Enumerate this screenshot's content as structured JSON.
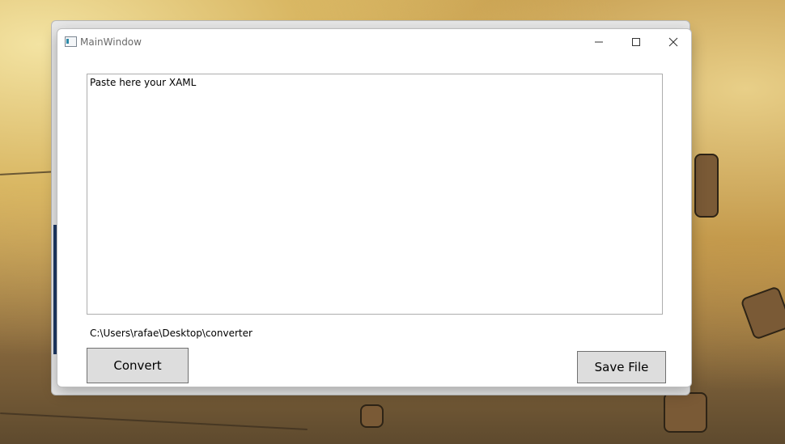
{
  "window": {
    "title": "MainWindow"
  },
  "editor": {
    "placeholder": "Paste here your XAML",
    "value": "Paste here your XAML"
  },
  "path": {
    "text": "C:\\Users\\rafae\\Desktop\\converter"
  },
  "buttons": {
    "convert_label": "Convert",
    "save_label": "Save File"
  },
  "icons": {
    "app": "app-window-icon",
    "minimize": "minimize-icon",
    "maximize": "maximize-icon",
    "close": "close-icon"
  },
  "colors": {
    "button_bg": "#dddddd",
    "button_border": "#707070",
    "window_bg": "#ffffff"
  }
}
